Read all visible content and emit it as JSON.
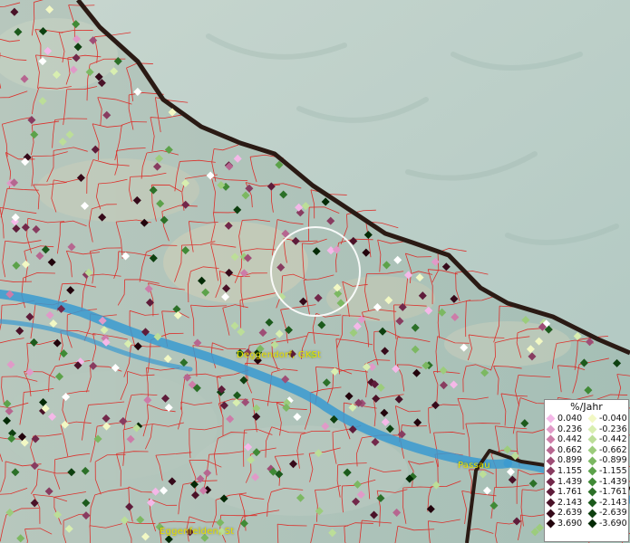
{
  "map": {
    "places": [
      {
        "id": "deggendorf",
        "label": "Deggendorf, GKSt"
      },
      {
        "id": "passau",
        "label": "Passau"
      },
      {
        "id": "eggenfelden",
        "label": "Eggenfelden, St"
      }
    ],
    "colors": {
      "boundary": "#e0201c",
      "border": "#2a1a14",
      "river": "#3a9ad0",
      "terrain_low": "#a9c1b8",
      "terrain_high": "#c6d4ce"
    }
  },
  "legend": {
    "title": "%/Jahr",
    "positive": [
      {
        "value": "0.040",
        "color": "#f4b8e8"
      },
      {
        "value": "0.236",
        "color": "#e09ac8"
      },
      {
        "value": "0.442",
        "color": "#cc7ca8"
      },
      {
        "value": "0.662",
        "color": "#b66690"
      },
      {
        "value": "0.899",
        "color": "#9e4e76"
      },
      {
        "value": "1.155",
        "color": "#883c60"
      },
      {
        "value": "1.439",
        "color": "#72284a"
      },
      {
        "value": "1.761",
        "color": "#5e1c3a"
      },
      {
        "value": "2.143",
        "color": "#4a1228"
      },
      {
        "value": "2.639",
        "color": "#360a1a"
      },
      {
        "value": "3.690",
        "color": "#22040c"
      }
    ],
    "negative": [
      {
        "value": "-0.040",
        "color": "#f2f8c4"
      },
      {
        "value": "-0.236",
        "color": "#d8eeb0"
      },
      {
        "value": "-0.442",
        "color": "#bcde98"
      },
      {
        "value": "-0.662",
        "color": "#9ccc7c"
      },
      {
        "value": "-0.899",
        "color": "#7cb862"
      },
      {
        "value": "-1.155",
        "color": "#5ca24a"
      },
      {
        "value": "-1.439",
        "color": "#408a36"
      },
      {
        "value": "-1.761",
        "color": "#2c7028"
      },
      {
        "value": "-2.143",
        "color": "#1c5a1c"
      },
      {
        "value": "-2.639",
        "color": "#0e4010"
      },
      {
        "value": "-3.690",
        "color": "#042a06"
      }
    ]
  }
}
